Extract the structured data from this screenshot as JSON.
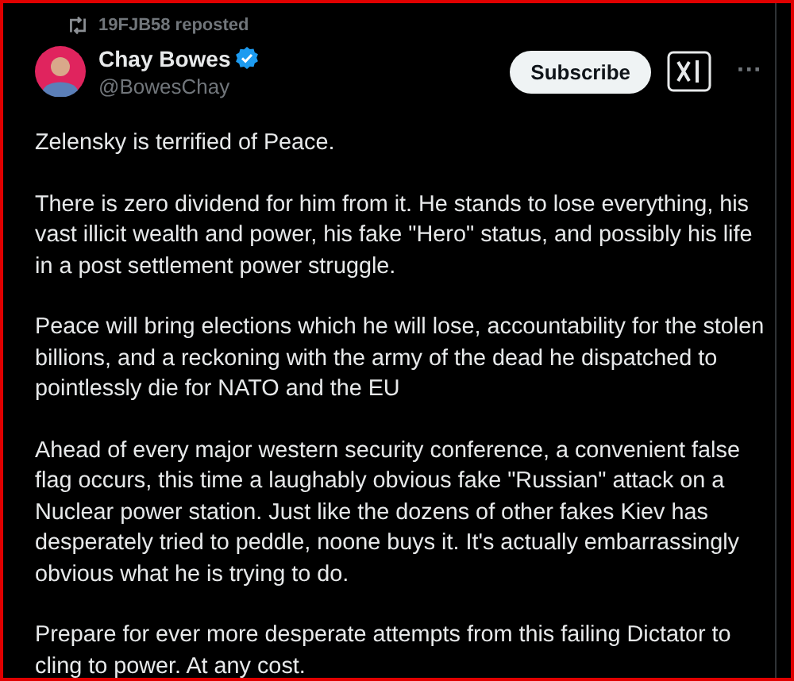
{
  "repost": {
    "label": "19FJB58 reposted"
  },
  "author": {
    "name": "Chay Bowes",
    "handle": "@BowesChay",
    "verified": true
  },
  "subscribe_button": "Subscribe",
  "more": "···",
  "paragraphs": [
    "Zelensky is terrified of Peace.",
    "There is zero dividend for him from it. He stands to lose everything, his vast illicit wealth and power, his fake \"Hero\" status, and possibly his life in a post settlement power struggle.",
    "Peace will bring elections which he will lose, accountability for the stolen billions, and a reckoning  with the army of the dead he dispatched to pointlessly die for NATO and the EU",
    "Ahead of every major western security conference, a convenient false flag occurs, this time a laughably obvious fake \"Russian\" attack on a Nuclear power station. Just like the dozens of other fakes Kiev has desperately tried to peddle, noone buys it. It's actually embarrassingly obvious what he is trying to do.",
    "Prepare for ever more desperate attempts from this failing Dictator to cling to power. At any cost."
  ]
}
